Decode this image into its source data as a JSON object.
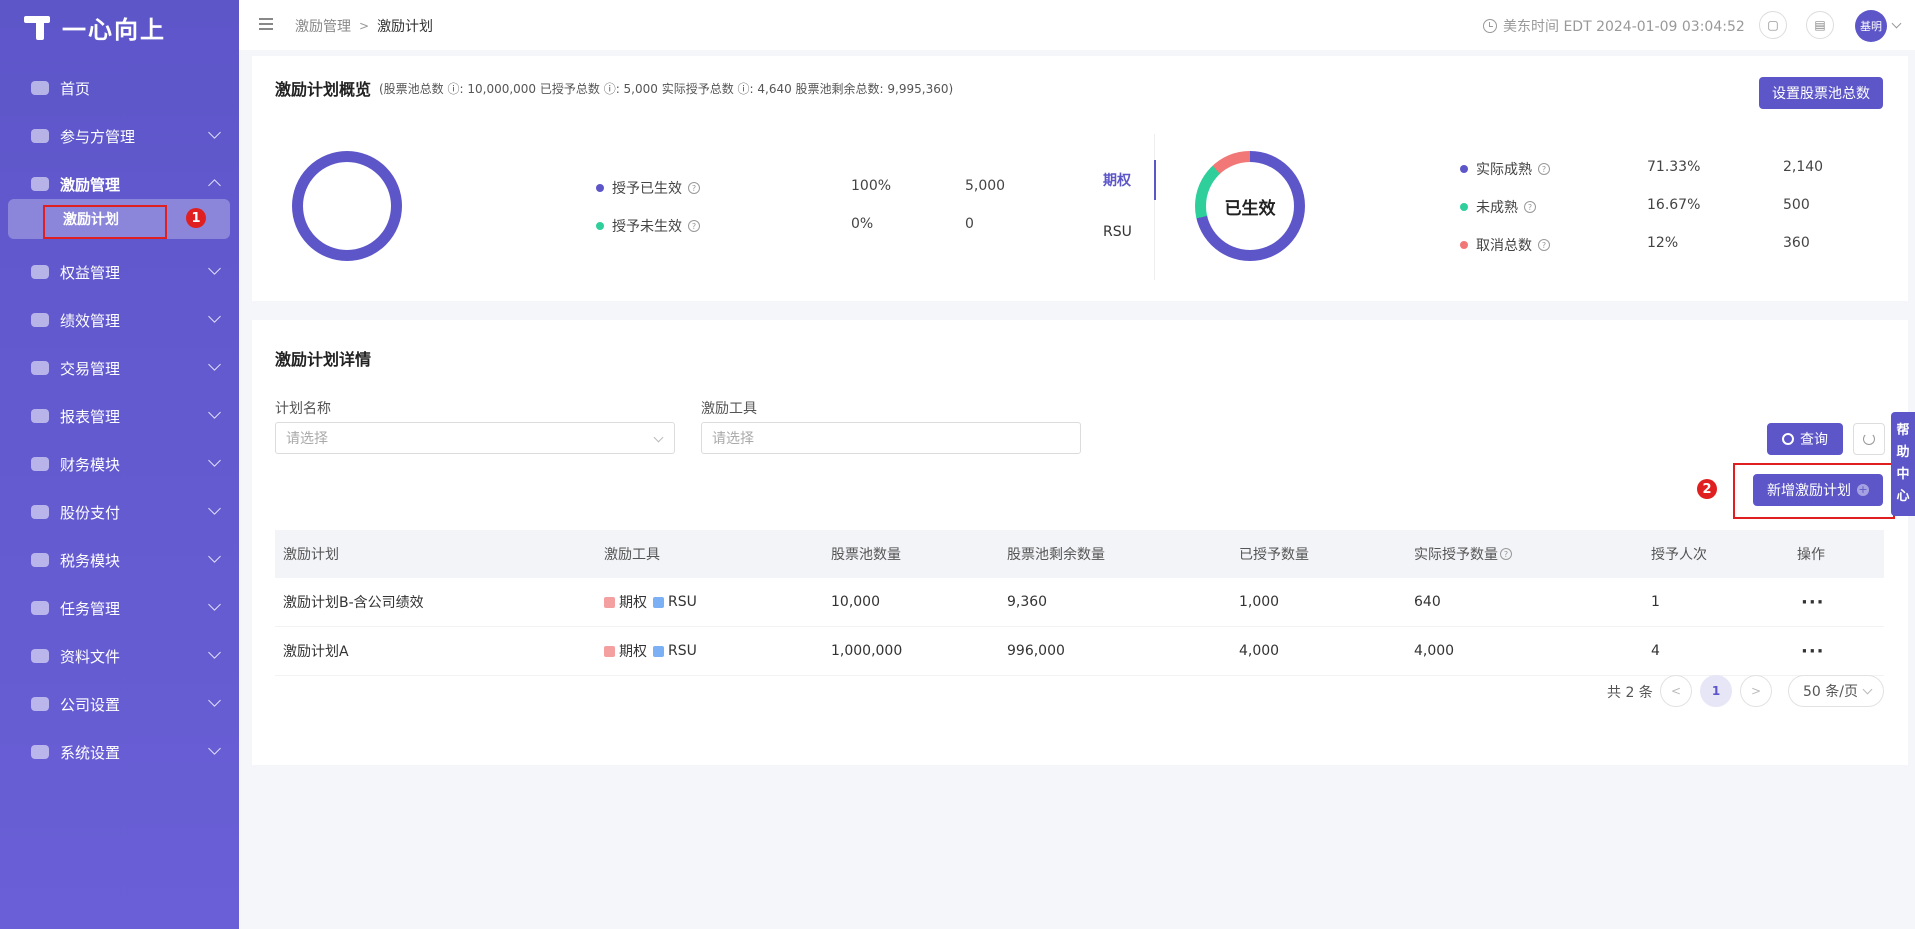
{
  "app": {
    "logo_text": "一心向上"
  },
  "sidebar": {
    "items": [
      {
        "label": "首页",
        "icon": "home-icon"
      },
      {
        "label": "参与方管理",
        "icon": "users-icon"
      },
      {
        "label": "激励管理",
        "icon": "incentive-icon",
        "expanded": true
      },
      {
        "label": "权益管理",
        "icon": "equity-icon"
      },
      {
        "label": "绩效管理",
        "icon": "performance-icon"
      },
      {
        "label": "交易管理",
        "icon": "trade-icon"
      },
      {
        "label": "报表管理",
        "icon": "report-icon"
      },
      {
        "label": "财务模块",
        "icon": "finance-icon"
      },
      {
        "label": "股份支付",
        "icon": "payment-icon"
      },
      {
        "label": "税务模块",
        "icon": "tax-icon"
      },
      {
        "label": "任务管理",
        "icon": "task-icon"
      },
      {
        "label": "资料文件",
        "icon": "file-icon"
      },
      {
        "label": "公司设置",
        "icon": "company-icon"
      },
      {
        "label": "系统设置",
        "icon": "settings-icon"
      }
    ],
    "active_sub": "激励计划"
  },
  "annotations": {
    "badge1": "1",
    "badge2": "2"
  },
  "header": {
    "breadcrumb": [
      "激励管理",
      "激励计划"
    ],
    "breadcrumb_sep": ">",
    "timezone": "美东时间 EDT 2024-01-09 03:04:52",
    "avatar": "基明"
  },
  "overview": {
    "title": "激励计划概览",
    "summary": "(股票池总数 ⓘ: 10,000,000   已授予总数 ⓘ: 5,000   实际授予总数 ⓘ: 4,640   股票池剩余总数: 9,995,360)",
    "set_pool_button": "设置股票池总数",
    "grant_legend": [
      {
        "label": "授予已生效",
        "pct": "100%",
        "value": "5,000",
        "color": "#5d56c9"
      },
      {
        "label": "授予未生效",
        "pct": "0%",
        "value": "0",
        "color": "#2fcf9c"
      }
    ],
    "tabs": [
      "期权",
      "RSU"
    ],
    "ring_center": "已生效",
    "vest_legend": [
      {
        "label": "实际成熟",
        "pct": "71.33%",
        "value": "2,140",
        "color": "#5d56c9"
      },
      {
        "label": "未成熟",
        "pct": "16.67%",
        "value": "500",
        "color": "#2fcf9c"
      },
      {
        "label": "取消总数",
        "pct": "12%",
        "value": "360",
        "color": "#f27777"
      }
    ]
  },
  "details": {
    "title": "激励计划详情",
    "filters": {
      "plan_name_label": "计划名称",
      "plan_name_placeholder": "请选择",
      "tool_label": "激励工具",
      "tool_placeholder": "请选择"
    },
    "query_button": "查询",
    "add_button": "新增激励计划",
    "help_tab": [
      "帮",
      "助",
      "中",
      "心"
    ],
    "table": {
      "headers": [
        "激励计划",
        "激励工具",
        "股票池数量",
        "股票池剩余数量",
        "已授予数量",
        "实际授予数量",
        "授予人次",
        "操作"
      ],
      "rows": [
        {
          "name": "激励计划B-含公司绩效",
          "tool1": "期权",
          "tool2": "RSU",
          "pool": "10,000",
          "remaining": "9,360",
          "granted": "1,000",
          "actual": "640",
          "count": "1",
          "action": "···"
        },
        {
          "name": "激励计划A",
          "tool1": "期权",
          "tool2": "RSU",
          "pool": "1,000,000",
          "remaining": "996,000",
          "granted": "4,000",
          "actual": "4,000",
          "count": "4",
          "action": "···"
        }
      ]
    },
    "pagination": {
      "total": "共 2 条",
      "current": "1",
      "page_size": "50 条/页",
      "prev": "<",
      "next": ">"
    }
  }
}
